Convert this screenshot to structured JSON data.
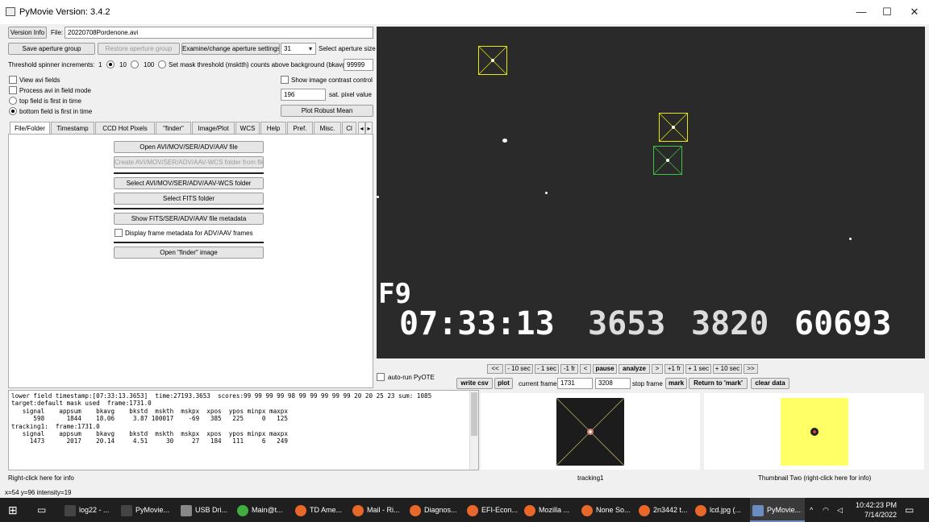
{
  "window": {
    "title": "PyMovie  Version: 3.4.2",
    "min": "—",
    "max": "☐",
    "close": "✕"
  },
  "top": {
    "version_btn": "Version Info",
    "file_label": "File:",
    "file_value": "20220708Pordenone.avi",
    "save_aperture": "Save aperture group",
    "restore_aperture": "Restore aperture group",
    "examine_aperture": "Examine/change aperture settings",
    "aperture_size_value": "31",
    "aperture_size_label": "Select aperture size",
    "threshold_label": "Threshold spinner increments:",
    "radio_1": "1",
    "radio_10": "10",
    "radio_100": "100",
    "mask_label": "Set mask threshold (msktth) counts above background (bkavg)",
    "mask_value": "99999",
    "view_avi_fields": "View avi fields",
    "process_field_mode": "Process avi in field mode",
    "top_field_first": "top field is first in time",
    "bottom_field_first": "bottom field is first in time",
    "show_contrast": "Show image contrast control",
    "sat_value": "196",
    "sat_label": "sat. pixel value",
    "plot_robust": "Plot Robust Mean"
  },
  "tabs": [
    "File/Folder",
    "Timestamp",
    "CCD Hot Pixels",
    "\"finder\"",
    "Image/Plot",
    "WCS",
    "Help",
    "Pref.",
    "Misc.",
    "Cl"
  ],
  "file_folder": {
    "open_avi": "Open AVI/MOV/SER/ADV/AAV file",
    "create_wcs": "Create AVI/MOV/SER/ADV/AAV-WCS folder from file",
    "select_wcs_folder": "Select AVI/MOV/SER/ADV/AAV-WCS folder",
    "select_fits": "Select FITS folder",
    "show_metadata": "Show FITS/SER/ADV/AAV file metadata",
    "display_metadata": "Display frame metadata for ADV/AAV frames",
    "open_finder": "Open \"finder\" image"
  },
  "osd": {
    "field": "F9",
    "time": "07:33:13",
    "n1": "3653",
    "n2": "3820",
    "n3": "60693"
  },
  "nav": {
    "buttons": [
      "<<",
      "- 10 sec",
      "- 1 sec",
      "-1 fr",
      "<",
      "pause",
      "analyze",
      ">",
      "+1 fr",
      "+ 1 sec",
      "+ 10 sec",
      ">>"
    ],
    "auto_run": "auto-run PyOTE",
    "write_csv": "write csv",
    "plot": "plot",
    "current_frame_label": "current frame",
    "current_frame": "1731",
    "stop_frame": "3208",
    "stop_frame_label": "stop frame",
    "mark": "mark",
    "return_mark": "Return to 'mark'",
    "clear_data": "clear data"
  },
  "log_lines": [
    "lower field timestamp:[07:33:13.3653]  time:27193.3653  scores:99 99 99 99 98 99 99 99 99 99 20 20 25 23 sum: 1085",
    "",
    "target:default mask used  frame:1731.0",
    "   signal    appsum    bkavg    bkstd  mskth  mskpx  xpos  ypos minpx maxpx",
    "      598      1844    18.06     3.87 100017    -69   385   225     0   125",
    "",
    "tracking1:  frame:1731.0",
    "   signal    appsum    bkavg    bkstd  mskth  mskpx  xpos  ypos minpx maxpx",
    "     1473      2017    20.14     4.51     30     27   184   111     6   249"
  ],
  "status": {
    "right_click_info": "Right-click here for info",
    "thumb1_label": "tracking1",
    "thumb2_label": "Thumbnail Two (right-click here for info)",
    "coords": "x=54 y=96 intensity=19"
  },
  "taskbar": {
    "items": [
      {
        "label": "log22 - ...",
        "color": "#444"
      },
      {
        "label": "PyMovie...",
        "color": "#444"
      },
      {
        "label": "USB Dri...",
        "color": "#888"
      },
      {
        "label": "Main@t...",
        "color": "#3fae3f"
      },
      {
        "label": "TD Ame...",
        "color": "#e8682a"
      },
      {
        "label": "Mail - Ri...",
        "color": "#e8682a"
      },
      {
        "label": "Diagnos...",
        "color": "#e8682a"
      },
      {
        "label": "EFI-Econ...",
        "color": "#e8682a"
      },
      {
        "label": "Mozilla ...",
        "color": "#e8682a"
      },
      {
        "label": "None So...",
        "color": "#e8682a"
      },
      {
        "label": "2n3442 t...",
        "color": "#e8682a"
      },
      {
        "label": "lcd.jpg (...",
        "color": "#e8682a"
      },
      {
        "label": "PyMovie...",
        "color": "#6a8cc0"
      }
    ],
    "time": "10:42:23 PM",
    "date": "7/14/2022"
  },
  "colors": {
    "aperture_yellow": "#e8e800",
    "aperture_green": "#3ec43e",
    "thumb2_bg": "#ffff66"
  }
}
